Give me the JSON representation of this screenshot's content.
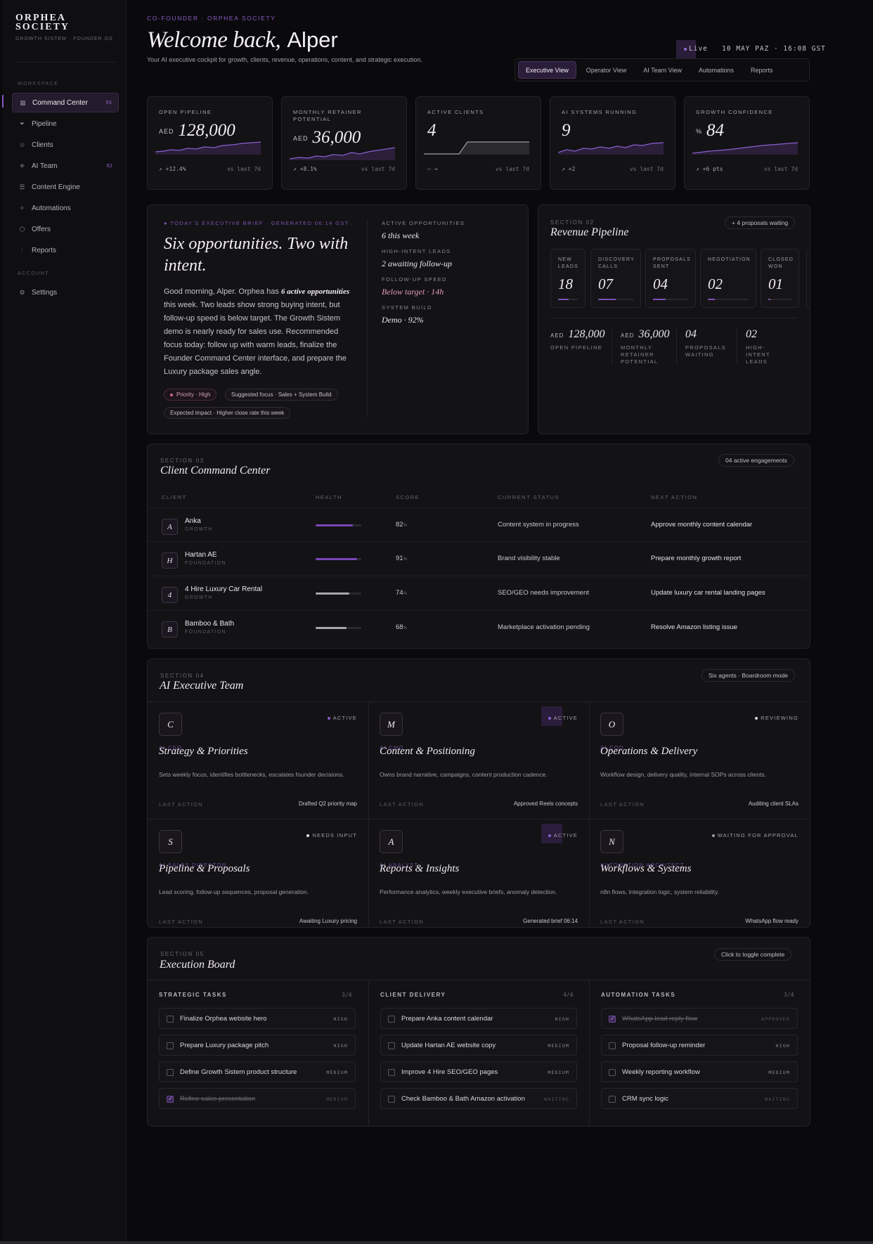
{
  "sidebar": {
    "brand_line1": "ORPHEA",
    "brand_line2": "SOCIETY",
    "brand_sub": "GROWTH SISTEM · FOUNDER OS",
    "workspace_label": "WORKSPACE",
    "account_label": "ACCOUNT",
    "items": [
      {
        "label": "Command Center",
        "icon": "grid-icon",
        "count": "03"
      },
      {
        "label": "Pipeline",
        "icon": "filter-icon"
      },
      {
        "label": "Clients",
        "icon": "user-icon"
      },
      {
        "label": "AI Team",
        "icon": "sparkle-icon",
        "count": "02"
      },
      {
        "label": "Content Engine",
        "icon": "lines-icon"
      },
      {
        "label": "Automations",
        "icon": "bolt-icon"
      },
      {
        "label": "Offers",
        "icon": "package-icon"
      },
      {
        "label": "Reports",
        "icon": "chart-icon"
      }
    ],
    "settings_label": "Settings"
  },
  "header": {
    "eyebrow": "CO-FOUNDER · ORPHEA SOCIETY",
    "welcome_italic": "Welcome back,",
    "welcome_name": "Alper",
    "intro": "Your AI executive cockpit for growth, clients, revenue, operations, content, and strategic execution.",
    "live_label": "Live",
    "live_time": "10 MAY PAZ · 16:08 GST",
    "tabs": [
      "Executive View",
      "Operator View",
      "AI Team View",
      "Automations",
      "Reports"
    ]
  },
  "kpis": [
    {
      "label": "OPEN PIPELINE",
      "unit": "AED",
      "value": "128,000",
      "delta": "↗ +12.4%",
      "compare": "vs last 7d"
    },
    {
      "label": "MONTHLY RETAINER POTENTIAL",
      "unit": "AED",
      "value": "36,000",
      "delta": "↗ +8.1%",
      "compare": "vs last 7d"
    },
    {
      "label": "ACTIVE CLIENTS",
      "unit": "",
      "value": "4",
      "delta": "— →",
      "compare": "vs last 7d"
    },
    {
      "label": "AI SYSTEMS RUNNING",
      "unit": "",
      "value": "9",
      "delta": "↗ +2",
      "compare": "vs last 7d"
    },
    {
      "label": "GROWTH CONFIDENCE",
      "unit": "%",
      "value": "84",
      "delta": "↗ +6 pts",
      "compare": "vs last 7d"
    }
  ],
  "brief": {
    "eyebrow": "TODAY'S EXECUTIVE BRIEF · GENERATED 06:14 GST",
    "title": "Six opportunities. Two with intent.",
    "body_pre": "Good morning, Alper. Orphea has ",
    "body_em": "6 active opportunities",
    "body_post": " this week. Two leads show strong buying intent, but follow-up speed is below target. The Growth Sistem demo is nearly ready for sales use. Recommended focus today: follow up with warm leads, finalize the Founder Command Center interface, and prepare the Luxury package sales angle.",
    "chips": [
      "Priority · High",
      "Suggested focus · Sales + System Build",
      "Expected impact · Higher close rate this week"
    ],
    "stats": [
      {
        "label": "ACTIVE OPPORTUNITIES",
        "value": "6 this week"
      },
      {
        "label": "HIGH-INTENT LEADS",
        "value": "2 awaiting follow-up"
      },
      {
        "label": "FOLLOW-UP SPEED",
        "value": "Below target · 14h"
      },
      {
        "label": "SYSTEM BUILD",
        "value": "Demo · 92%"
      }
    ]
  },
  "pipeline": {
    "section": "SECTION 02",
    "title": "Revenue Pipeline",
    "badge": "+ 4 proposals waiting",
    "stages": [
      {
        "label": "NEW LEADS",
        "value": "18",
        "progress": 0.55
      },
      {
        "label": "DISCOVERY CALLS",
        "value": "07",
        "progress": 0.5
      },
      {
        "label": "PROPOSALS SENT",
        "value": "04",
        "progress": 0.35
      },
      {
        "label": "NEGOTIATION",
        "value": "02",
        "progress": 0.18
      },
      {
        "label": "CLOSED WON",
        "value": "01",
        "progress": 0.1
      }
    ],
    "stats": [
      {
        "unit": "AED",
        "value": "128,000",
        "label": "OPEN PIPELINE"
      },
      {
        "unit": "AED",
        "value": "36,000",
        "label": "MONTHLY RETAINER POTENTIAL"
      },
      {
        "unit": "",
        "value": "04",
        "label": "PROPOSALS WAITING"
      },
      {
        "unit": "",
        "value": "02",
        "label": "HIGH-INTENT LEADS"
      }
    ]
  },
  "clients": {
    "section": "SECTION 03",
    "title": "Client Command Center",
    "badge": "04 active engagements",
    "columns": [
      "CLIENT",
      "HEALTH",
      "SCORE",
      "CURRENT STATUS",
      "NEXT ACTION"
    ],
    "rows": [
      {
        "initial": "A",
        "name": "Anka",
        "tier": "GROWTH",
        "health": 0.82,
        "score": "82",
        "status": "Content system in progress",
        "next": "Approve monthly content calendar",
        "color": "#7a46b8"
      },
      {
        "initial": "H",
        "name": "Hartan AE",
        "tier": "FOUNDATION",
        "health": 0.91,
        "score": "91",
        "status": "Brand visibility stable",
        "next": "Prepare monthly growth report",
        "color": "#7a46b8"
      },
      {
        "initial": "4",
        "name": "4 Hire Luxury Car Rental",
        "tier": "GROWTH",
        "health": 0.74,
        "score": "74",
        "status": "SEO/GEO needs improvement",
        "next": "Update luxury car rental landing pages",
        "color": "#a9a5ad"
      },
      {
        "initial": "B",
        "name": "Bamboo & Bath",
        "tier": "FOUNDATION",
        "health": 0.68,
        "score": "68",
        "status": "Marketplace activation pending",
        "next": "Resolve Amazon listing issue",
        "color": "#a9a5ad"
      }
    ],
    "score_suffix": "%"
  },
  "team": {
    "section": "SECTION 04",
    "title": "AI Executive Team",
    "badge": "Six agents · Boardroom mode",
    "last_action_label": "LAST ACTION",
    "agents": [
      {
        "initial": "C",
        "role": "AI CEO",
        "name": "Strategy & Priorities",
        "desc": "Sets weekly focus, identifies bottlenecks, escalates founder decisions.",
        "status": "ACTIVE",
        "status_color": "#8a5fd0",
        "last": "Drafted Q2 priority map",
        "highlight": false
      },
      {
        "initial": "M",
        "role": "AI CMO",
        "name": "Content & Positioning",
        "desc": "Owns brand narrative, campaigns, content production cadence.",
        "status": "ACTIVE",
        "status_color": "#8a5fd0",
        "last": "Approved Reels concepts",
        "highlight": true
      },
      {
        "initial": "O",
        "role": "AI COO",
        "name": "Operations & Delivery",
        "desc": "Workflow design, delivery quality, internal SOPs across clients.",
        "status": "REVIEWING",
        "status_color": "#d8d4dc",
        "last": "Auditing client SLAs",
        "highlight": false
      },
      {
        "initial": "S",
        "role": "AI SALES DIRECTOR",
        "name": "Pipeline & Proposals",
        "desc": "Lead scoring, follow-up sequences, proposal generation.",
        "status": "NEEDS INPUT",
        "status_color": "#e8e4ec",
        "last": "Awaiting Luxury pricing",
        "highlight": false
      },
      {
        "initial": "A",
        "role": "AI ANALYST",
        "name": "Reports & Insights",
        "desc": "Performance analytics, weekly executive briefs, anomaly detection.",
        "status": "ACTIVE",
        "status_color": "#8a5fd0",
        "last": "Generated brief 06:14",
        "highlight": true
      },
      {
        "initial": "N",
        "role": "AUTOMATION ARCHITECT",
        "name": "Workflows & Systems",
        "desc": "n8n flows, integration logic, system reliability.",
        "status": "WAITING FOR APPROVAL",
        "status_color": "#a09ba6",
        "last": "WhatsApp flow ready",
        "highlight": false
      }
    ]
  },
  "board": {
    "section": "SECTION 05",
    "title": "Execution Board",
    "badge": "Click to toggle complete",
    "columns": [
      {
        "title": "STRATEGIC TASKS",
        "count": "3/4",
        "tasks": [
          {
            "label": "Finalize Orphea website hero",
            "priority": "HIGH",
            "done": false
          },
          {
            "label": "Prepare Luxury package pitch",
            "priority": "HIGH",
            "done": false
          },
          {
            "label": "Define Growth Sistem product structure",
            "priority": "MEDIUM",
            "done": false
          },
          {
            "label": "Refine sales presentation",
            "priority": "MEDIUM",
            "done": true
          }
        ]
      },
      {
        "title": "CLIENT DELIVERY",
        "count": "4/4",
        "tasks": [
          {
            "label": "Prepare Anka content calendar",
            "priority": "HIGH",
            "done": false
          },
          {
            "label": "Update Hartan AE website copy",
            "priority": "MEDIUM",
            "done": false
          },
          {
            "label": "Improve 4 Hire SEO/GEO pages",
            "priority": "MEDIUM",
            "done": false
          },
          {
            "label": "Check Bamboo & Bath Amazon activation",
            "priority": "WAITING",
            "done": false
          }
        ]
      },
      {
        "title": "AUTOMATION TASKS",
        "count": "3/4",
        "tasks": [
          {
            "label": "WhatsApp lead reply flow",
            "priority": "APPROVED",
            "done": true
          },
          {
            "label": "Proposal follow-up reminder",
            "priority": "HIGH",
            "done": false
          },
          {
            "label": "Weekly reporting workflow",
            "priority": "MEDIUM",
            "done": false
          },
          {
            "label": "CRM sync logic",
            "priority": "WAITING",
            "done": false
          }
        ]
      }
    ]
  },
  "colors": {
    "accent": "#8a5fd0",
    "background": "#0a090b",
    "card": "#131215",
    "warning": "#e39cb3"
  }
}
